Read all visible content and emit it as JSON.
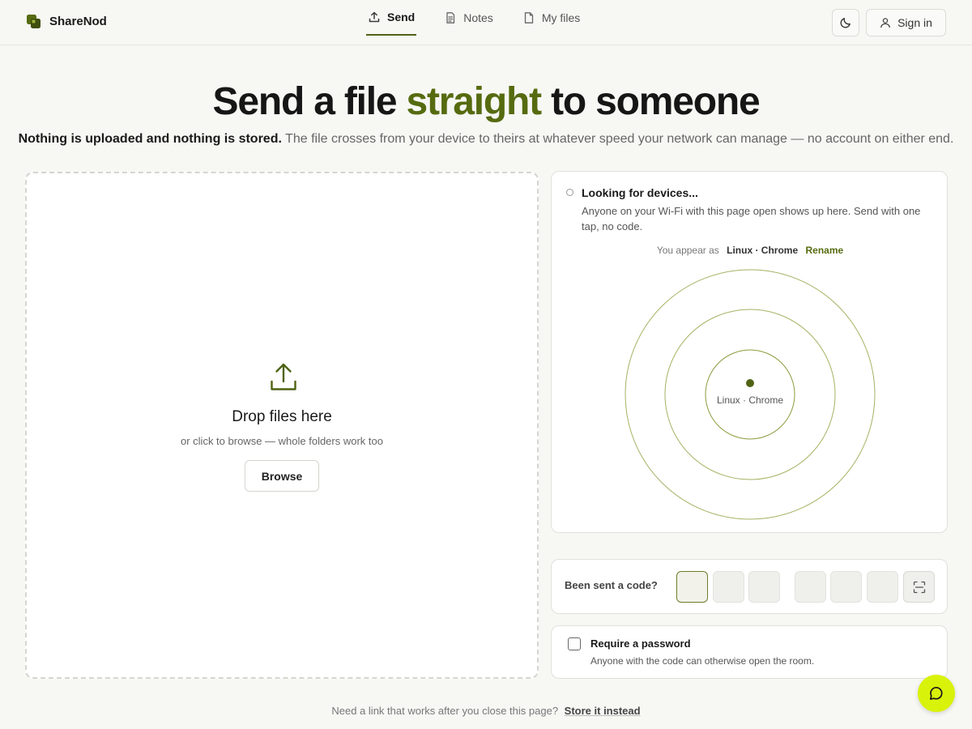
{
  "brand": {
    "name": "ShareNod",
    "logo": "brand-logo-icon"
  },
  "nav": {
    "items": [
      {
        "label": "Send",
        "icon": "upload-icon",
        "active": true
      },
      {
        "label": "Notes",
        "icon": "document-icon",
        "active": false
      },
      {
        "label": "My files",
        "icon": "file-icon",
        "active": false
      }
    ]
  },
  "header": {
    "theme_icon": "moon-icon",
    "signin_label": "Sign in",
    "signin_icon": "user-icon"
  },
  "hero": {
    "title_pre": "Send a file ",
    "title_accent": "straight",
    "title_post": " to someone",
    "sub_strong": "Nothing is uploaded and nothing is stored.",
    "sub_rest": " The file crosses from your device to theirs at whatever speed your network can manage — no account on either end."
  },
  "dropzone": {
    "title": "Drop files here",
    "subtitle": "or click to browse — whole folders work too",
    "browse_label": "Browse",
    "icon": "upload-icon"
  },
  "devices": {
    "status": "Looking for devices...",
    "description": "Anyone on your Wi-Fi with this page open shows up here. Send with one tap, no code.",
    "appear_as_label": "You appear as",
    "device_name": "Linux · Chrome",
    "rename_label": "Rename",
    "radar_label": "Linux · Chrome"
  },
  "code": {
    "label": "Been sent a code?",
    "box_count": 6,
    "scan_icon": "scan-icon"
  },
  "password": {
    "label": "Require a password",
    "description": "Anyone with the code can otherwise open the room.",
    "checked": false
  },
  "footer": {
    "note": "Need a link that works after you close this page?",
    "link": "Store it instead"
  },
  "chat": {
    "icon": "chat-bubble-icon"
  },
  "colors": {
    "accent": "#566b10",
    "chat_button": "#d9f20a",
    "background": "#f7f7f4"
  }
}
